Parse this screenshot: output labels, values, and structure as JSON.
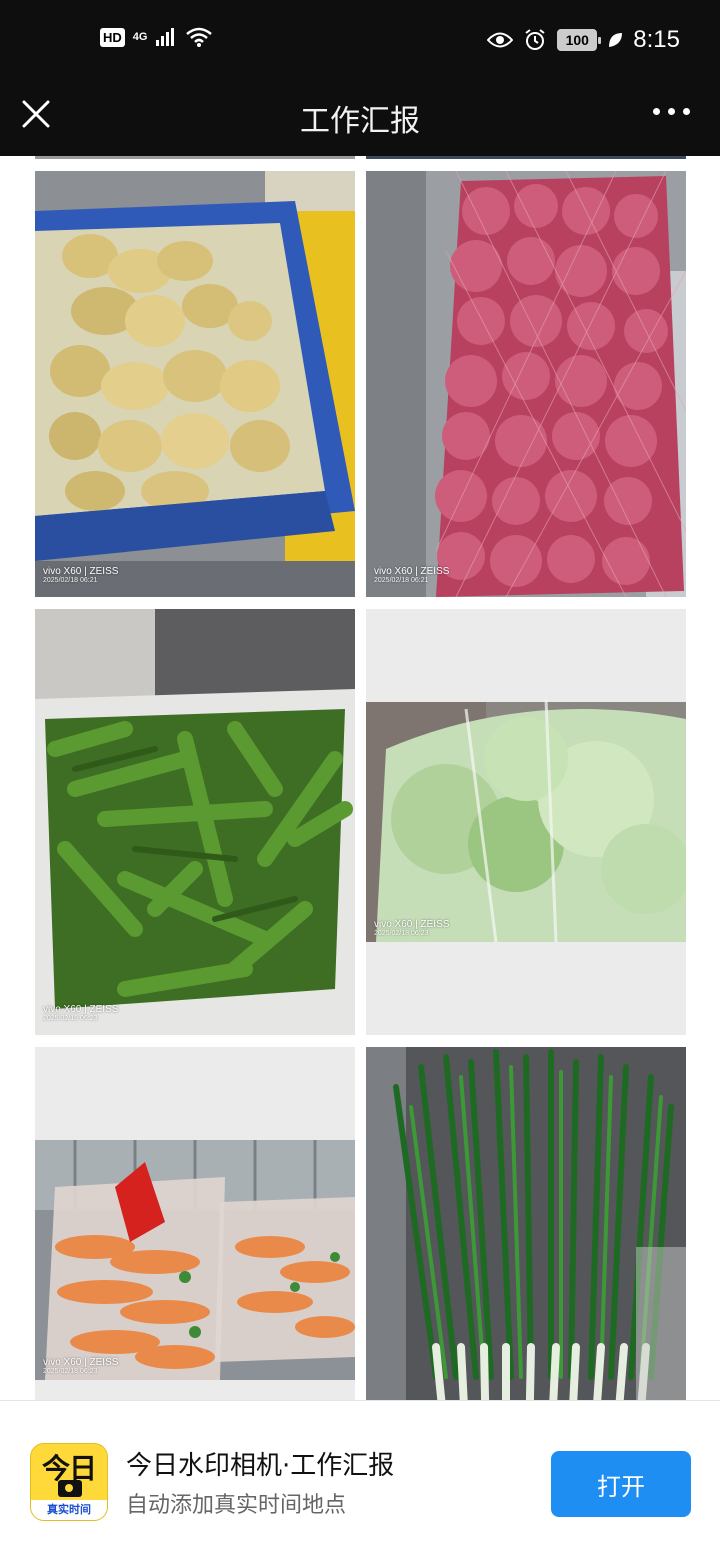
{
  "status_bar": {
    "hd": "HD",
    "network": "4G",
    "battery": "100",
    "time": "8:15"
  },
  "nav": {
    "title": "工作汇报",
    "close_icon": "close-icon",
    "more_icon": "more-dots-icon"
  },
  "photos": [
    {
      "subject": "potatoes-in-blue-crate",
      "brand": "vivo X60 | ZEISS",
      "stamp": "2025/02/18 06:21"
    },
    {
      "subject": "red-onions-in-mesh-bag",
      "brand": "vivo X60 | ZEISS",
      "stamp": "2025/02/18 06:21"
    },
    {
      "subject": "green-peppers-in-bag",
      "brand": "vivo X60 | ZEISS",
      "stamp": "2025/02/18 06:23"
    },
    {
      "subject": "lettuce-in-plastic-bag",
      "brand": "vivo X60 | ZEISS",
      "stamp": "2025/02/18 06:23"
    },
    {
      "subject": "carrots-in-plastic-bags",
      "brand": "vivo X60 | ZEISS",
      "stamp": "2025/02/18 06:23"
    },
    {
      "subject": "green-onions-bundle",
      "brand": "",
      "stamp": ""
    }
  ],
  "banner": {
    "icon_big": "今日",
    "icon_foot": "真实时间",
    "title": "今日水印相机·工作汇报",
    "subtitle": "自动添加真实时间地点",
    "open_label": "打开"
  },
  "colors": {
    "topbar_bg": "#0e0e0e",
    "accent_button": "#1e8ef2",
    "app_icon_yellow": "#ffd83a"
  }
}
